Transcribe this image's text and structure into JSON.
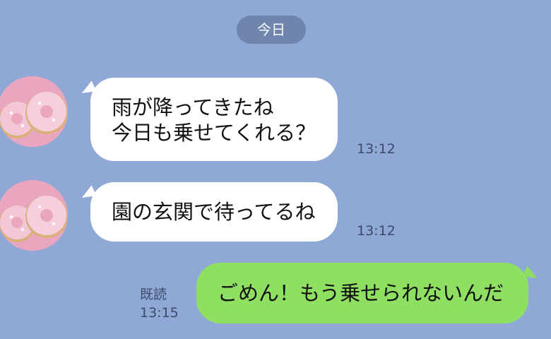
{
  "date_divider": {
    "label": "今日"
  },
  "messages": [
    {
      "side": "incoming",
      "text": "雨が降ってきたね\n今日も乗せてくれる？",
      "time": "13:12",
      "avatar": "donut-avatar"
    },
    {
      "side": "incoming",
      "text": "園の玄関で待ってるね",
      "time": "13:12",
      "avatar": "donut-avatar"
    },
    {
      "side": "outgoing",
      "text": "ごめん！もう乗せられないんだ",
      "read_label": "既読",
      "time": "13:15"
    }
  ],
  "colors": {
    "background": "#8fa8d6",
    "incoming_bubble": "#ffffff",
    "outgoing_bubble": "#8fe062",
    "date_pill": "#6f85ad",
    "meta_text": "#3c4a66"
  }
}
